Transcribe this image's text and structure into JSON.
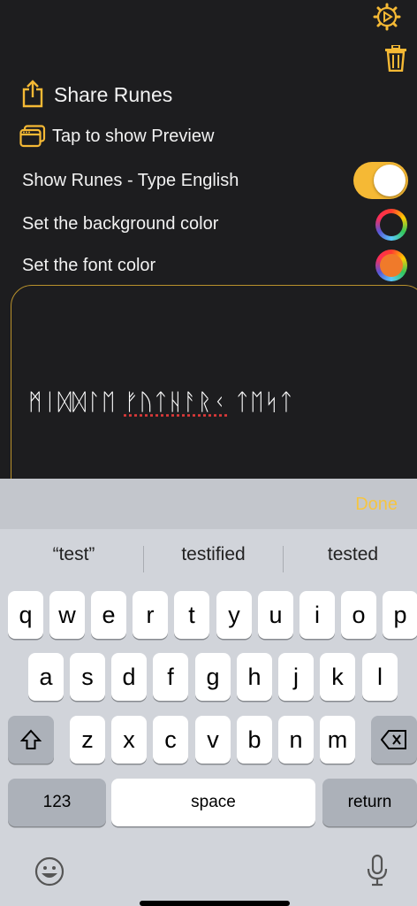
{
  "header": {
    "settings_icon": "gear-play-icon",
    "trash_icon": "trash-icon"
  },
  "menu": {
    "share_label": "Share Runes",
    "preview_label": "Tap to show Preview",
    "show_runes_label": "Show Runes - Type English",
    "show_runes_on": true,
    "bg_color_label": "Set the background color",
    "bg_color": "#1d1d1f",
    "font_color_label": "Set the font color",
    "font_color": "#f07a2a",
    "accent": "#f5b935"
  },
  "editor": {
    "runes_word1": "ᛗᛁᛞᛞᛚᛖ",
    "runes_word2": "ᚠᚢᛏᚺᚨᚱᚲ",
    "runes_word3": "ᛏᛖᛋᛏ"
  },
  "keyboard": {
    "done_label": "Done",
    "suggestions": [
      "“test”",
      "testified",
      "tested"
    ],
    "row1": [
      "q",
      "w",
      "e",
      "r",
      "t",
      "y",
      "u",
      "i",
      "o",
      "p"
    ],
    "row2": [
      "a",
      "s",
      "d",
      "f",
      "g",
      "h",
      "j",
      "k",
      "l"
    ],
    "row3": [
      "z",
      "x",
      "c",
      "v",
      "b",
      "n",
      "m"
    ],
    "numbers_label": "123",
    "space_label": "space",
    "return_label": "return"
  }
}
